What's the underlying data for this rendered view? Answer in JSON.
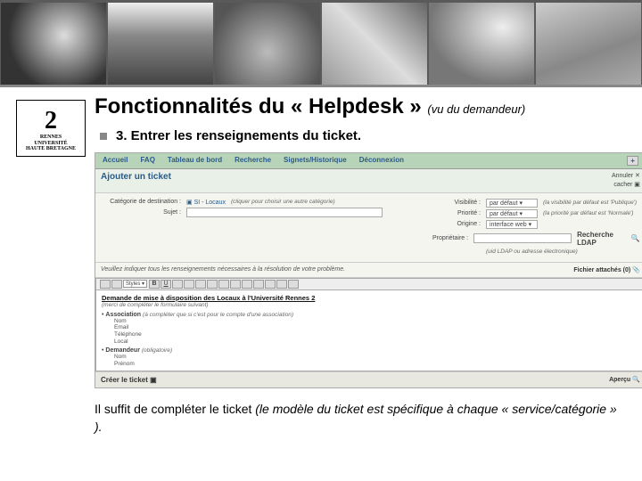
{
  "slide": {
    "title": "Fonctionnalités du « Helpdesk »",
    "title_sub": "(vu du demandeur)",
    "bullet": "3. Entrer les renseignements du ticket.",
    "note": "Il suffit de compléter le ticket ",
    "note_italic": "(le modèle du ticket est spécifique à chaque « service/catégorie » )."
  },
  "logo": {
    "big": "2",
    "line1": "RENNES",
    "line2": "UNIVERSITÉ",
    "line3": "HAUTE BRETAGNE"
  },
  "nav": {
    "items": [
      "Accueil",
      "FAQ",
      "Tableau de bord",
      "Recherche",
      "Signets/Historique",
      "Déconnexion"
    ],
    "plus": "+"
  },
  "panel": {
    "title": "Ajouter un ticket",
    "links": {
      "cancel": "Annuler",
      "hide": "cacher"
    }
  },
  "form_left": {
    "cat_label": "Catégorie de destination :",
    "cat_value": "SI - Locaux",
    "cat_hint": "(cliquer pour choisir une autre catégorie)",
    "subj_label": "Sujet :"
  },
  "form_right": {
    "vis_label": "Visibilité :",
    "vis_sel": "par défaut",
    "vis_note": "(la visibilité par défaut est 'Publique')",
    "pri_label": "Priorité :",
    "pri_sel": "par défaut",
    "pri_note": "(la priorité par défaut est 'Normale')",
    "ori_label": "Origine :",
    "ori_sel": "interface web",
    "own_label": "Propriétaire :",
    "own_search": "Recherche LDAP",
    "own_hint": "(uid LDAP ou adresse électronique)"
  },
  "instr": {
    "text": "Veuillez indiquer tous les renseignements nécessaires à la résolution de votre problème.",
    "attach": "Fichier attachés (0)"
  },
  "toolbar": {
    "style_sel": "Styles"
  },
  "editor": {
    "title": "Demande de mise à disposition des Locaux à l'Université Rennes 2",
    "subtitle": "(merci de compléter le formulaire suivant)",
    "assoc_label": "Association",
    "assoc_hint": "(à compléter que si c'est pour le compte d'une association)",
    "assoc_fields": [
      "Nom",
      "Email",
      "Téléphone",
      "Local"
    ],
    "dem_label": "Demandeur",
    "dem_hint": "(obligatoire)",
    "dem_fields": [
      "Nom",
      "Prénom"
    ]
  },
  "footer": {
    "create": "Créer le ticket",
    "preview": "Aperçu"
  }
}
